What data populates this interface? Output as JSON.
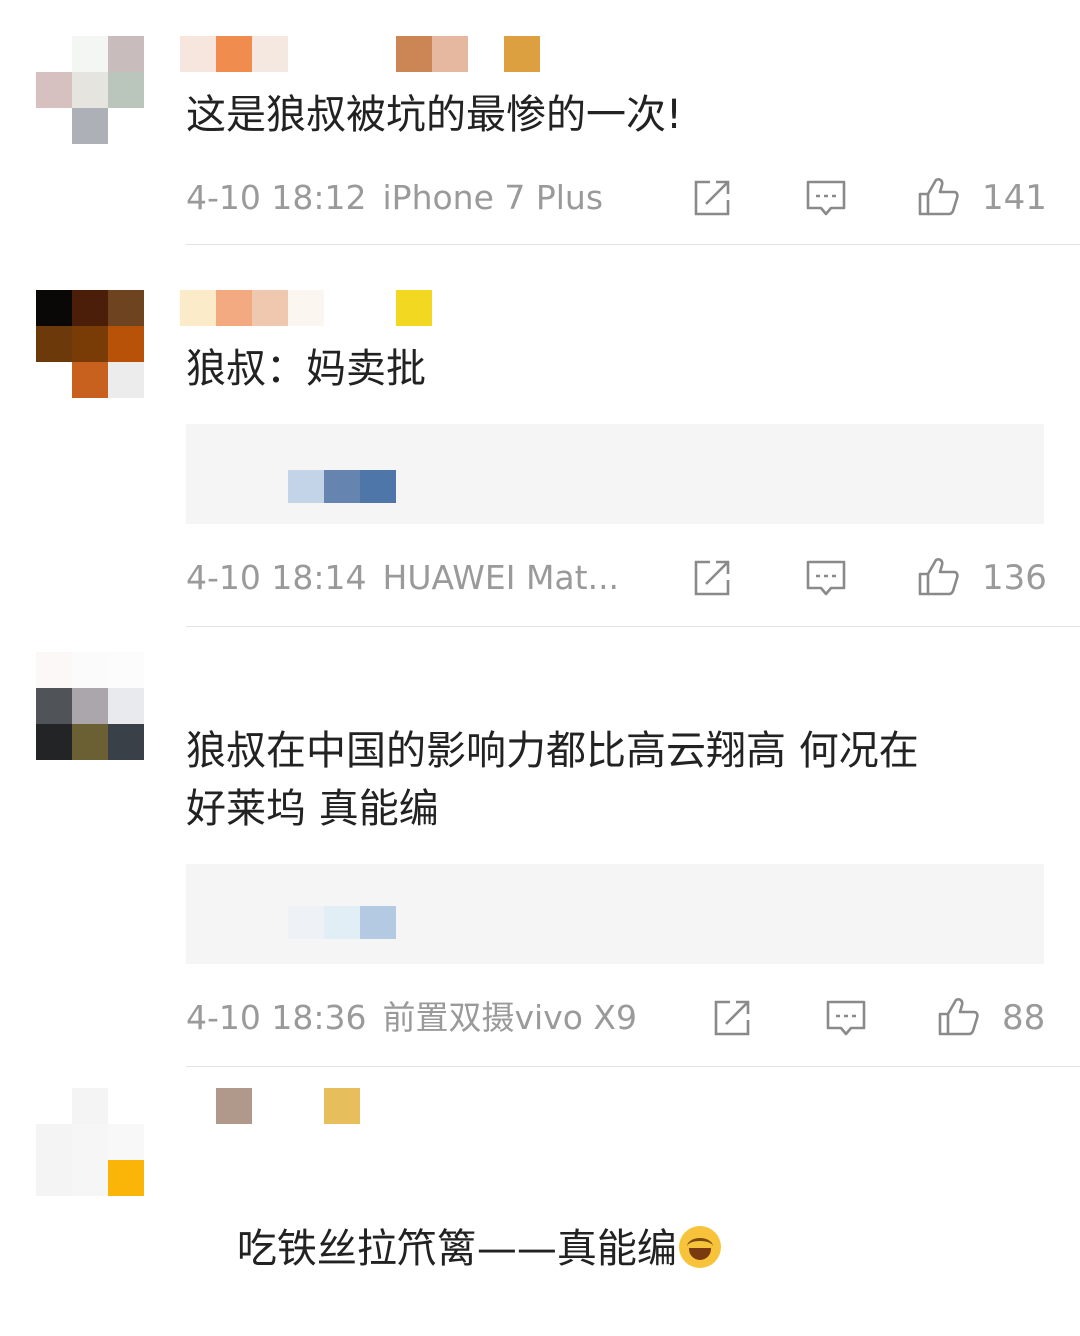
{
  "comments": [
    {
      "text": "这是狼叔被坑的最惨的一次!",
      "time": "4-10 18:12",
      "device": "iPhone 7 Plus",
      "likes": "141",
      "has_quote": false
    },
    {
      "text": "狼叔：妈卖批",
      "time": "4-10 18:14",
      "device": "HUAWEI Mat...",
      "likes": "136",
      "has_quote": true
    },
    {
      "text": "狼叔在中国的影响力都比高云翔高 何况在\n好莱坞 真能编",
      "time": "4-10 18:36",
      "device": "前置双摄vivo X9",
      "likes": "88",
      "has_quote": true
    },
    {
      "text": "吃铁丝拉笊篱——真能编",
      "emoji": "laughing-crying-face",
      "has_quote": false
    }
  ],
  "icons": {
    "share": "share-icon",
    "reply": "comment-icon",
    "like": "thumbs-up-icon"
  },
  "colors": {
    "meta_text": "#9a9a9a",
    "body_text": "#222222",
    "quote_bg": "#f5f5f5",
    "divider": "#e2e2e2"
  }
}
